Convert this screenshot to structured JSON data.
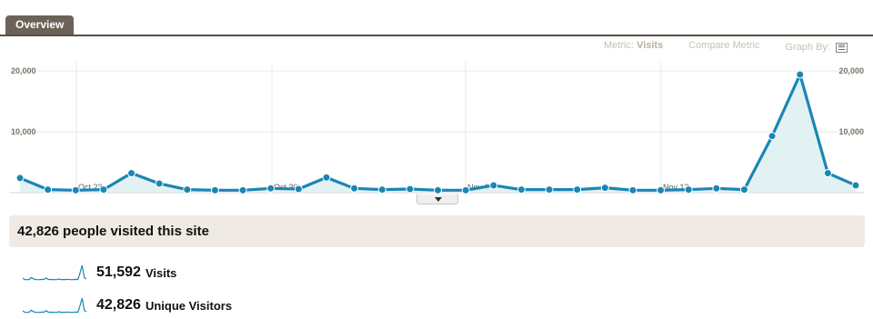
{
  "tab": {
    "label": "Overview"
  },
  "toolbar": {
    "metric_prefix": "Metric:",
    "metric_value": "Visits",
    "compare": "Compare Metric",
    "graph_by": "Graph By:",
    "graph_by_icon": "list-icon"
  },
  "chart_data": {
    "type": "line",
    "x_ticks": [
      "Oct 23",
      "Oct 30",
      "Nov 6",
      "Nov 13"
    ],
    "y_ticks_left": [
      "20,000",
      "10,000"
    ],
    "y_ticks_right": [
      "20,000",
      "10,000"
    ],
    "ylim": [
      0,
      20000
    ],
    "grid": true,
    "series": [
      {
        "color": "#1a86b5",
        "fill": "#dff0f0",
        "values": [
          2400,
          500,
          400,
          500,
          3200,
          1500,
          500,
          400,
          400,
          700,
          600,
          2500,
          700,
          500,
          600,
          400,
          400,
          1200,
          500,
          500,
          500,
          800,
          400,
          400,
          500,
          700,
          500,
          9300,
          19400,
          3200,
          1200
        ]
      }
    ]
  },
  "summary": {
    "text": "42,826 people visited this site"
  },
  "stats": [
    {
      "value": "51,592",
      "label": "Visits",
      "spark_icon": "visits-sparkline"
    },
    {
      "value": "42,826",
      "label": "Unique Visitors",
      "spark_icon": "visitors-sparkline"
    }
  ]
}
